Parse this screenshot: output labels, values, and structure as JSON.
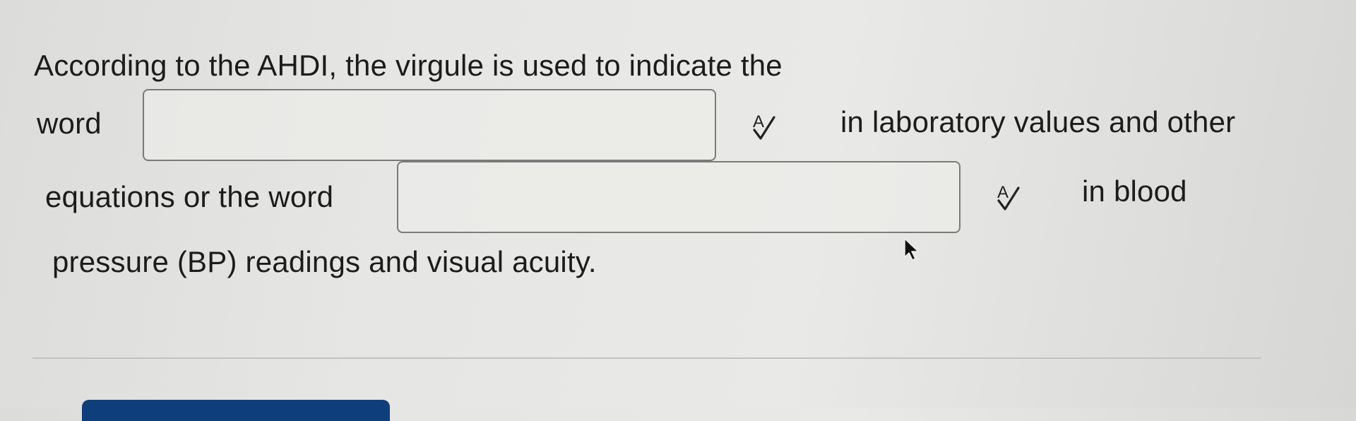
{
  "question": {
    "line1": "According to the AHDI, the virgule is used to indicate the",
    "line2_before": "word",
    "line2_after": "in laboratory values and other",
    "line3_before": "equations or the word",
    "line3_after": "in blood",
    "line4": "pressure (BP) readings and visual acuity."
  },
  "blanks": [
    {
      "value": "",
      "placeholder": ""
    },
    {
      "value": "",
      "placeholder": ""
    }
  ],
  "icons": {
    "spellcheck": "spellcheck-icon",
    "cursor": "mouse-pointer-icon"
  },
  "colors": {
    "button": "#0e3f7a",
    "input_border": "#7a7a7a",
    "text": "#1c1c1c"
  }
}
